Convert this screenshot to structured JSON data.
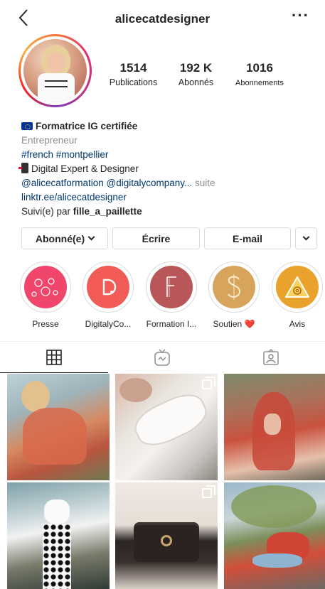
{
  "header": {
    "username": "alicecatdesigner",
    "more_label": "···"
  },
  "stats": {
    "posts": {
      "value": "1514",
      "label": "Publications"
    },
    "followers": {
      "value": "192 K",
      "label": "Abonnés"
    },
    "following": {
      "value": "1016",
      "label": "Abonnements"
    }
  },
  "bio": {
    "name": "Formatrice IG certifiée",
    "category": "Entrepreneur",
    "hashtags": "#french #montpellier",
    "line_phone": "Digital Expert & Designer",
    "mentions": "@alicecatformation @digitalycompany...",
    "more": "suite",
    "link": "linktr.ee/alicecatdesigner",
    "followed_by_prefix": "Suivi(e) par",
    "followed_by_user": "fille_a_paillette"
  },
  "buttons": {
    "following": "Abonné(e)",
    "message": "Écrire",
    "email": "E-mail"
  },
  "highlights": [
    {
      "label": "Presse"
    },
    {
      "label": "DigitalyCo..."
    },
    {
      "label": "Formation I..."
    },
    {
      "label": "Soutien ❤️"
    },
    {
      "label": "Avis"
    }
  ],
  "icons": {
    "back": "chevron-left-icon",
    "grid": "grid-icon",
    "igtv": "igtv-icon",
    "tagged": "tagged-icon",
    "multi": "carousel-icon"
  },
  "colors": {
    "link": "#00376b",
    "secondary": "#8e8e8e",
    "text": "#262626",
    "border": "#dbdbdb"
  }
}
